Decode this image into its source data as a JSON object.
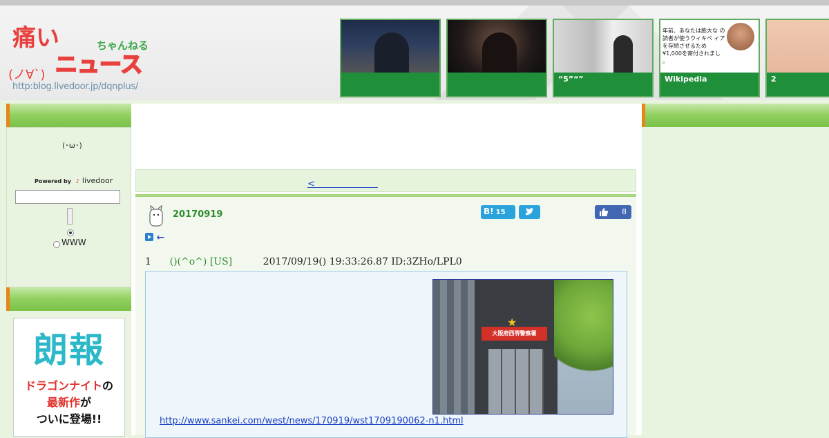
{
  "header": {
    "logo": {
      "title_top": "痛い",
      "title_main": "ニュース",
      "title_suffix": "ちゃんねる",
      "face": "(ノ∀`)",
      "url": "http:blog.livedoor.jp/dqnplus/"
    },
    "thumbs": [
      {
        "caption": ""
      },
      {
        "caption": ""
      },
      {
        "caption": "“5”“”"
      },
      {
        "caption": "Wikipedia",
        "image_text": "年前、あなたは膨大な の読者が使うウィキペ ィアを存続させるため ¥1,000を寄付されまし 。"
      },
      {
        "caption": "2"
      }
    ]
  },
  "sidebar": {
    "smiley": "(･ω･)",
    "powered_by": "Powered by",
    "brand": "livedoor",
    "search": {
      "value": "",
      "placeholder": ""
    },
    "radio_www_label": "WWW",
    "ad": {
      "kanji": "朗報",
      "line1_red": "ドラゴンナイト",
      "line1_black": "の",
      "line2_red": "最新作",
      "line2_black": "が",
      "line3": "ついに登場!!"
    }
  },
  "main": {
    "nav_link": "<　　　　　　　",
    "article": {
      "title": "20170919",
      "hatena_label": "B!",
      "hatena_count": "15",
      "like_count": "8",
      "back_arrow": "←",
      "post": {
        "number": "1",
        "name": "()(^o^) [US]",
        "datetime": "2017/09/19() 19:33:26.87 ID:3ZHo/LPL0",
        "photo_sign": "大阪府西堺警察署",
        "link": "http://www.sankei.com/west/news/170919/wst1709190062-n1.html"
      }
    }
  },
  "colors": {
    "accent_green": "#2e8b2e",
    "header_green": "#1f8f3a",
    "link_blue": "#1a3fc0",
    "sidebar_bar": "#8fcf5e",
    "sidebar_accent": "#e8861a",
    "hatena_blue": "#2aa3dc",
    "facebook_blue": "#4267b2"
  },
  "icons": [
    "smiley-icon",
    "livedoor-logo-icon",
    "hatena-bookmark-icon",
    "twitter-icon",
    "thumbs-up-icon",
    "play-icon",
    "back-arrow-icon",
    "author-avatar-icon"
  ]
}
